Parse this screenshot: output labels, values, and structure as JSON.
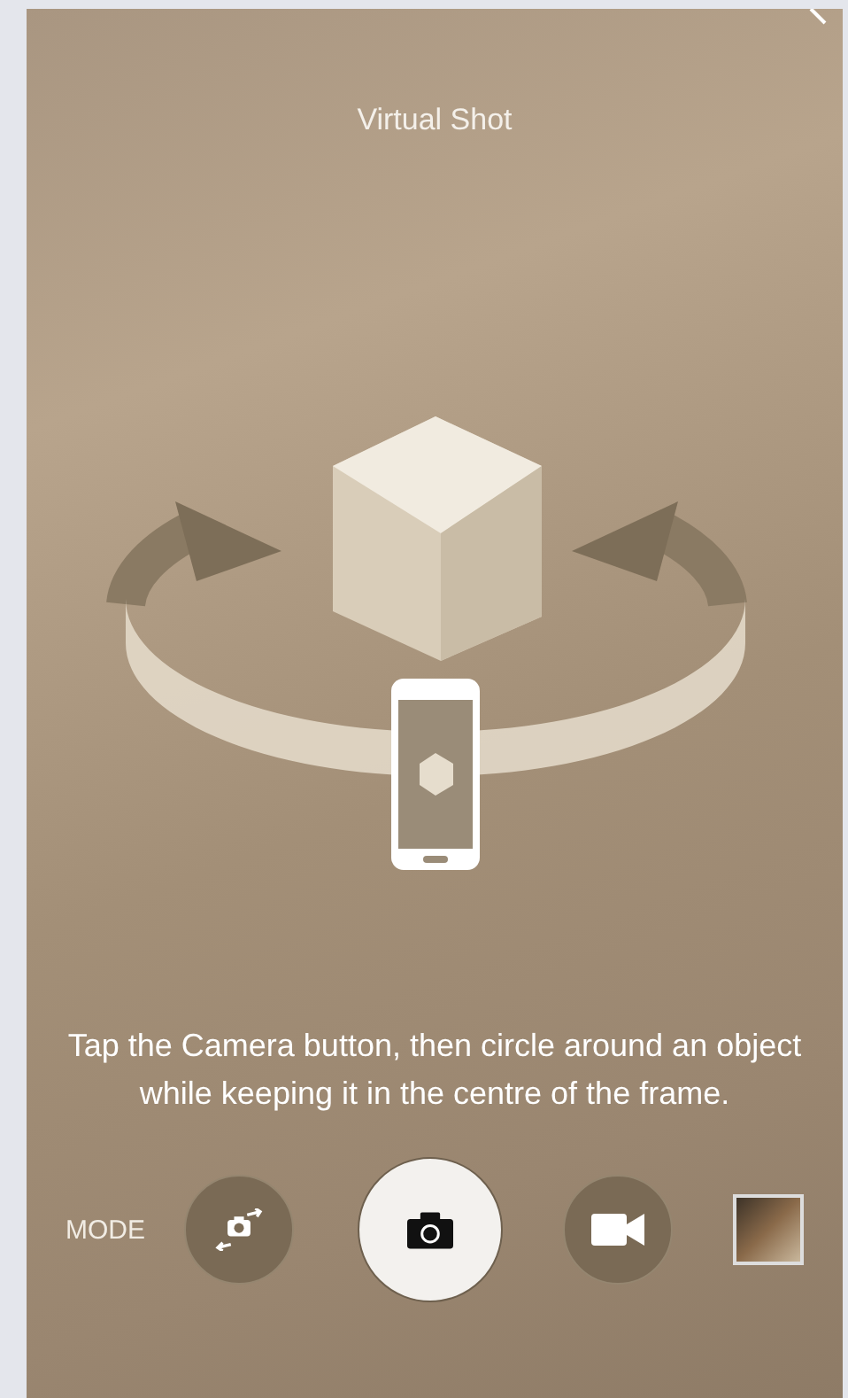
{
  "screen": {
    "title": "Virtual Shot",
    "instruction": "Tap the Camera button, then circle around an object while keeping it in the centre of the frame."
  },
  "controls": {
    "mode_label": "MODE",
    "buttons": [
      {
        "kind": "virtual-shot"
      },
      {
        "kind": "shutter"
      },
      {
        "kind": "video"
      },
      {
        "kind": "gallery"
      }
    ]
  }
}
